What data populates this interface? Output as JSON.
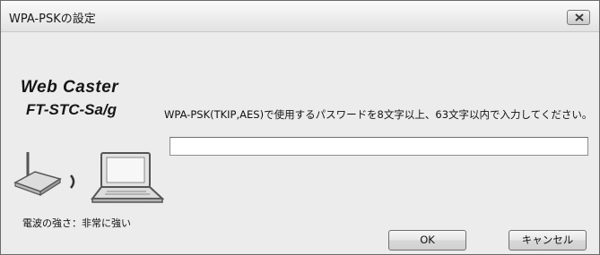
{
  "window": {
    "title": "WPA-PSKの設定",
    "close_icon": "close-icon"
  },
  "logo": {
    "line1": "Web Caster",
    "line2": "FT-STC-Sa/g"
  },
  "illustration": {
    "router_icon": "wireless-router-icon",
    "signal_icon": "signal-wave-icon",
    "laptop_icon": "laptop-icon",
    "signal_label": "電波の強さ：非常に強い"
  },
  "form": {
    "instruction": "WPA-PSK(TKIP,AES)で使用するパスワードを8文字以上、63文字以内で入力してください。",
    "password_value": ""
  },
  "buttons": {
    "ok_label": "OK",
    "cancel_label": "キャンセル"
  }
}
